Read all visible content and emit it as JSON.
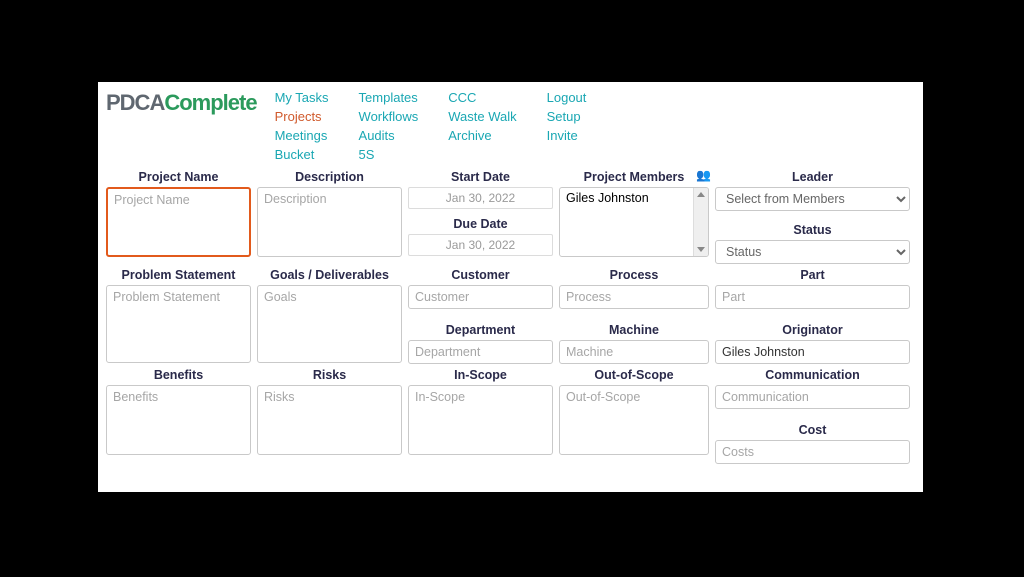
{
  "logo": {
    "part1": "PDCA",
    "part2": "Complete"
  },
  "nav": {
    "col1": [
      "My Tasks",
      "Projects",
      "Meetings",
      "Bucket"
    ],
    "col2": [
      "Templates",
      "Workflows",
      "Audits",
      "5S"
    ],
    "col3": [
      "CCC",
      "Waste Walk",
      "Archive"
    ],
    "col4": [
      "Logout",
      "Setup",
      "Invite"
    ],
    "active": "Projects"
  },
  "labels": {
    "project_name": "Project Name",
    "description": "Description",
    "start_date": "Start Date",
    "project_members": "Project Members",
    "leader": "Leader",
    "due_date": "Due Date",
    "status": "Status",
    "problem_statement": "Problem Statement",
    "goals": "Goals / Deliverables",
    "customer": "Customer",
    "process": "Process",
    "part": "Part",
    "department": "Department",
    "machine": "Machine",
    "originator": "Originator",
    "benefits": "Benefits",
    "risks": "Risks",
    "in_scope": "In-Scope",
    "out_scope": "Out-of-Scope",
    "communication": "Communication",
    "cost": "Cost"
  },
  "placeholders": {
    "project_name": "Project Name",
    "description": "Description",
    "problem_statement": "Problem Statement",
    "goals": "Goals",
    "customer": "Customer",
    "process": "Process",
    "part": "Part",
    "department": "Department",
    "machine": "Machine",
    "benefits": "Benefits",
    "risks": "Risks",
    "in_scope": "In-Scope",
    "out_scope": "Out-of-Scope",
    "communication": "Communication",
    "costs": "Costs"
  },
  "values": {
    "start_date": "Jan 30, 2022",
    "due_date": "Jan 30, 2022",
    "members": "Giles Johnston",
    "leader_select": "Select from Members",
    "status_select": "Status",
    "originator": "Giles Johnston"
  },
  "icons": {
    "people": "👥"
  }
}
